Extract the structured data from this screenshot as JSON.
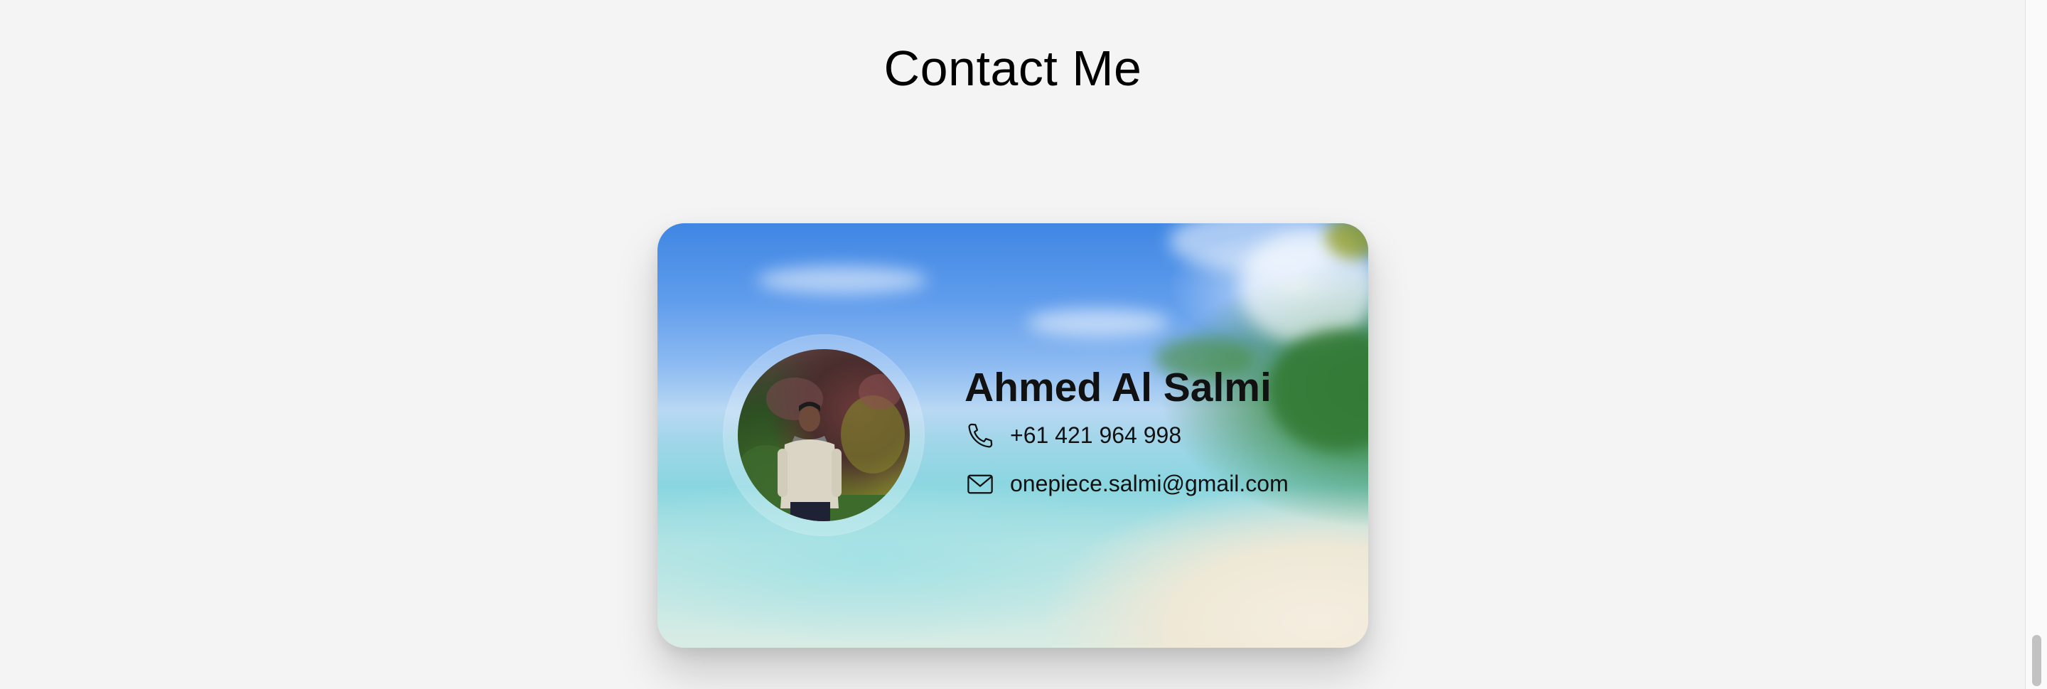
{
  "page": {
    "title": "Contact Me"
  },
  "card": {
    "name": "Ahmed Al Salmi",
    "phone": {
      "icon": "phone-icon",
      "value": "+61 421 964 998"
    },
    "email": {
      "icon": "mail-icon",
      "value": "onepiece.salmi@gmail.com"
    },
    "avatar": "profile-photo",
    "background": "blurred-beach-photo"
  },
  "colors": {
    "page_background": "#f4f4f4",
    "text": "#111111"
  }
}
